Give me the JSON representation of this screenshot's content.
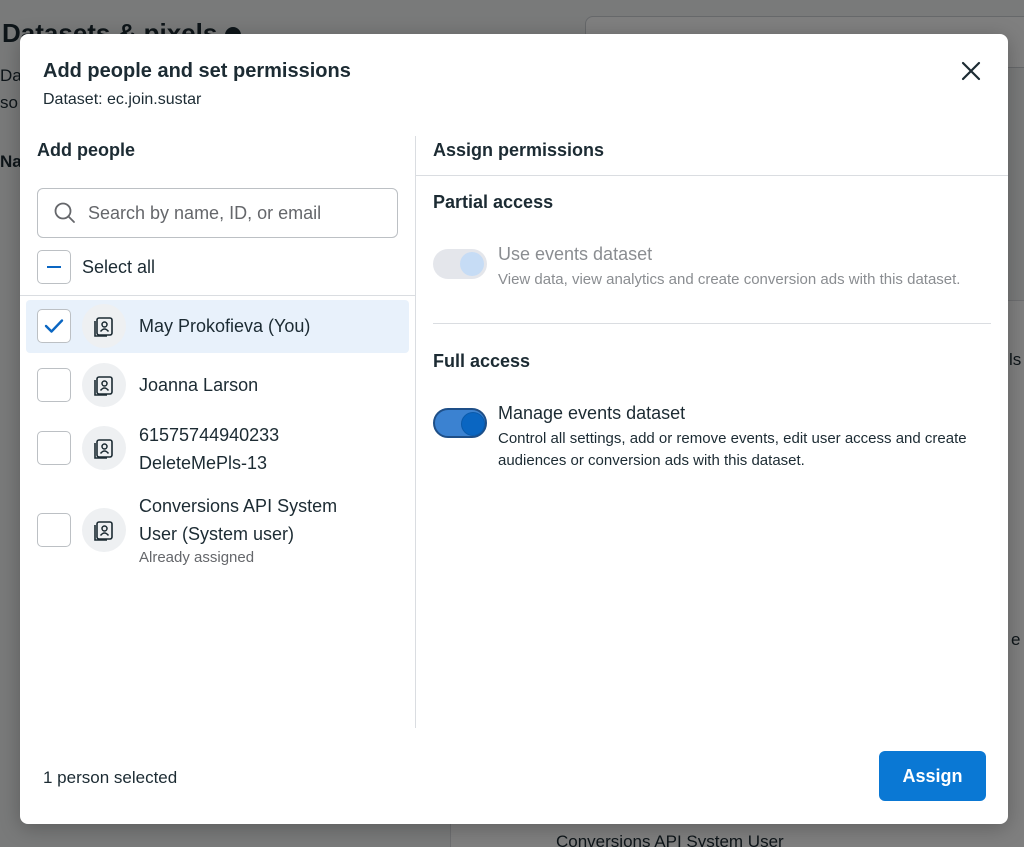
{
  "background": {
    "page_title": "Datasets & pixels",
    "bottom_text": "Conversions API System User",
    "fragments": [
      "Da",
      "so",
      "Na",
      "ls",
      "e"
    ]
  },
  "modal": {
    "title": "Add people and set permissions",
    "subtitle": "Dataset: ec.join.sustar",
    "close_icon": "close-icon"
  },
  "add_people": {
    "heading": "Add people",
    "search_placeholder": "Search by name, ID, or email",
    "select_all_label": "Select all",
    "people": [
      {
        "name": "May Prokofieva (You)",
        "sub": "",
        "checked": true
      },
      {
        "name": "Joanna Larson",
        "sub": "",
        "checked": false
      },
      {
        "name": "61575744940233 DeleteMePls-13",
        "sub": "",
        "checked": false
      },
      {
        "name": "Conversions API System User (System user)",
        "sub": "Already assigned",
        "checked": false
      }
    ]
  },
  "permissions": {
    "heading": "Assign permissions",
    "partial": {
      "title": "Partial access",
      "items": [
        {
          "title": "Use events dataset",
          "desc": "View data, view analytics and create conversion ads with this dataset.",
          "state": "disabled"
        }
      ]
    },
    "full": {
      "title": "Full access",
      "items": [
        {
          "title": "Manage events dataset",
          "desc": "Control all settings, add or remove events, edit user access and create audiences or conversion ads with this dataset.",
          "state": "on"
        }
      ]
    }
  },
  "footer": {
    "selection_status": "1 person selected",
    "assign_label": "Assign"
  },
  "colors": {
    "accent": "#0a78d4",
    "selected_row": "#e8f1fb"
  }
}
